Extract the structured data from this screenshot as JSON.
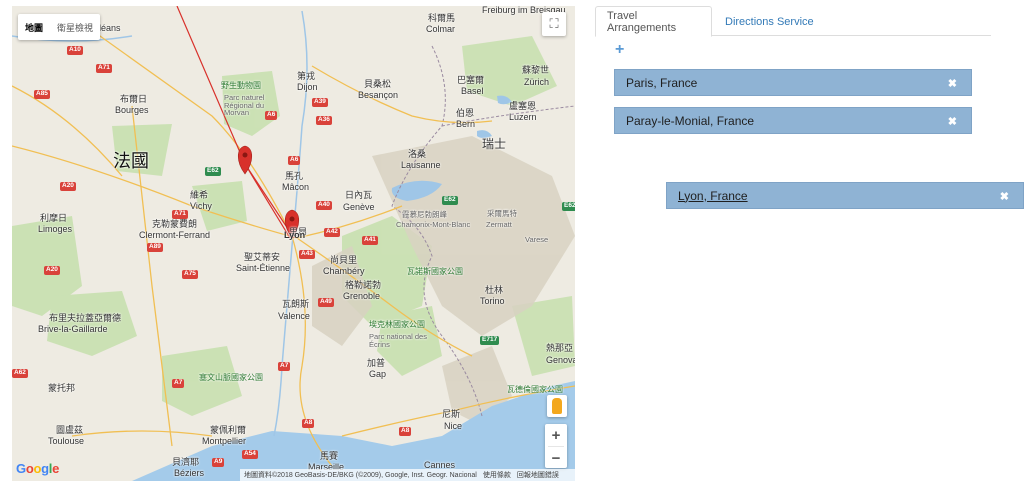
{
  "map": {
    "type_controls": [
      "地圖",
      "衛星檢視"
    ],
    "fullscreen_icon": "fullscreen-icon",
    "zoom": {
      "in": "+",
      "out": "−"
    },
    "google": {
      "G": "G",
      "o1": "o",
      "o2": "o",
      "g": "g",
      "l": "l",
      "e": "e"
    },
    "footer": [
      "地圖資料©2018 GeoBasis-DE/BKG (©2009), Google, Inst. Geogr. Nacional",
      "使用條款",
      "回報地圖錯誤"
    ],
    "labels": {
      "orleans": "Orléans",
      "bourges": "Bourges",
      "bourges_cn": "布爾日",
      "france": "法國",
      "dijon_cn": "第戎",
      "dijon": "Dijon",
      "besancon_cn": "貝桑松",
      "besancon": "Besançon",
      "bern_cn": "伯恩",
      "bern": "Bern",
      "basel_cn": "巴塞爾",
      "basel": "Basel",
      "zurich_cn": "蘇黎世",
      "zurich": "Zürich",
      "lucerne_cn": "盧塞恩",
      "lucerne": "Luzern",
      "swiss": "瑞士",
      "lausanne_cn": "洛桑",
      "lausanne": "Lausanne",
      "geneva_cn": "日內瓦",
      "geneva": "Genève",
      "macon_cn": "馬孔",
      "macon": "Mâcon",
      "vichy_cn": "維希",
      "vichy": "Vichy",
      "clermont_cn": "克勒蒙費朗",
      "clermont": "Clermont-Ferrand",
      "limoges_cn": "利摩日",
      "limoges": "Limoges",
      "lyon_cn": "里昂",
      "lyon": "Lyon",
      "st_etienne_cn": "聖艾蒂安",
      "st_etienne": "Saint-Étienne",
      "chambery_cn": "尚貝里",
      "chambery": "Chambéry",
      "grenoble_cn": "格勒諾勃",
      "grenoble": "Grenoble",
      "valence_cn": "瓦朗斯",
      "valence": "Valence",
      "torino_cn": "杜林",
      "torino": "Torino",
      "genova_cn": "熱那亞",
      "genova": "Genova",
      "nice_cn": "尼斯",
      "nice": "Nice",
      "cannes": "Cannes",
      "marseille_cn": "馬賽",
      "marseille": "Marseille",
      "montpellier_cn": "蒙佩利爾",
      "montpellier": "Montpellier",
      "toulouse_cn": "圖盧茲",
      "toulouse": "Toulouse",
      "beziers_cn": "貝濟耶",
      "beziers": "Béziers",
      "brive_cn": "布里夫拉蓋亞爾德",
      "brive": "Brive-la-Gaillarde",
      "colmar_cn": "科爾馬",
      "colmar": "Colmar",
      "freiburg_cn": "弗萊堡",
      "freiburg": "Freiburg im Breisgau",
      "chamonix_cn": "霞慕尼勃朗峰",
      "chamonix": "Chamonix-Mont-Blanc",
      "zermatt_cn": "采爾馬特",
      "zermatt": "Zermatt",
      "varese": "Varese",
      "gap_cn": "加普",
      "gap": "Gap",
      "morvan": "野生動物園",
      "morvan_en": "Parc naturel Régional du Morvan",
      "vanoise": "瓦諾斯國家公園",
      "ecrins": "埃克林國家公園",
      "ecrins_en": "Parc national des Écrins",
      "cevennes": "塞文山脈國家公園",
      "gran_paradiso": "瓦德倫國家公園",
      "cahors_cn": "蒙托邦"
    },
    "shields": [
      "A10",
      "A71",
      "A85",
      "A20",
      "A71",
      "A89",
      "A75",
      "A20",
      "A6",
      "A39",
      "A36",
      "A6",
      "A40",
      "A42",
      "A43",
      "A41",
      "A49",
      "A7",
      "A7",
      "A9",
      "A54",
      "A8",
      "E62",
      "E62",
      "E62",
      "E717",
      "A8",
      "A62"
    ]
  },
  "panel": {
    "tabs": [
      "Travel Arrangements",
      "Directions Service"
    ],
    "add_icon": "+",
    "stops": [
      "Paris, France",
      "Paray-le-Monial, France",
      "Lyon, France"
    ],
    "remove_icon": "✖"
  },
  "colors": {
    "stop_bg": "#8fb3d4",
    "link": "#337ab7",
    "marker": "#d8312b",
    "route": "#d8312b"
  }
}
